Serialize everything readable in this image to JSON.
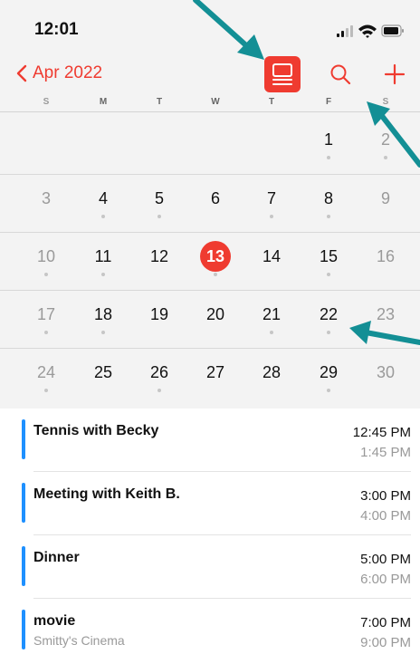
{
  "status_bar": {
    "time": "12:01"
  },
  "nav": {
    "back_label": "Apr 2022"
  },
  "weekdays": [
    "S",
    "M",
    "T",
    "W",
    "T",
    "F",
    "S"
  ],
  "weeks": [
    [
      null,
      null,
      null,
      null,
      null,
      "1",
      "2"
    ],
    [
      "3",
      "4",
      "5",
      "6",
      "7",
      "8",
      "9"
    ],
    [
      "10",
      "11",
      "12",
      "13",
      "14",
      "15",
      "16"
    ],
    [
      "17",
      "18",
      "19",
      "20",
      "21",
      "22",
      "23"
    ],
    [
      "24",
      "25",
      "26",
      "27",
      "28",
      "29",
      "30"
    ]
  ],
  "today": "13",
  "events": [
    {
      "title": "Tennis with Becky",
      "subtitle": "",
      "start": "12:45 PM",
      "end": "1:45 PM"
    },
    {
      "title": "Meeting with Keith B.",
      "subtitle": "",
      "start": "3:00 PM",
      "end": "4:00 PM"
    },
    {
      "title": "Dinner",
      "subtitle": "",
      "start": "5:00 PM",
      "end": "6:00 PM"
    },
    {
      "title": "movie",
      "subtitle": "Smitty's Cinema",
      "start": "7:00 PM",
      "end": "9:00 PM"
    }
  ],
  "colors": {
    "accent": "#ef3b30",
    "event_bar": "#1e90ff",
    "annotation_arrow": "#138f95"
  },
  "icons": [
    "chevron-left-icon",
    "list-view-icon",
    "search-icon",
    "plus-icon",
    "signal-icon",
    "wifi-icon",
    "battery-icon"
  ]
}
